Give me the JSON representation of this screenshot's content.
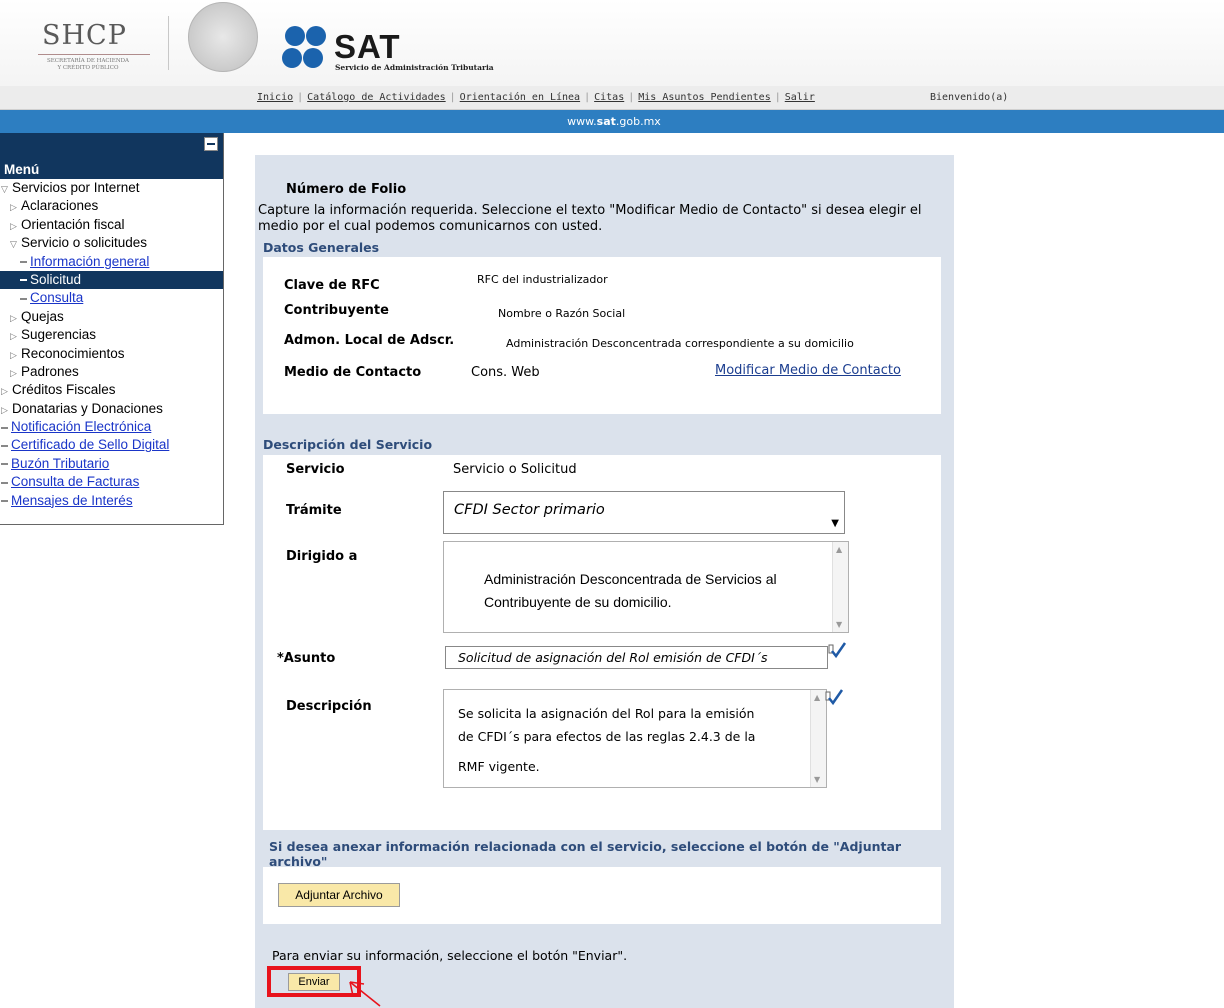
{
  "header": {
    "shcp_name": "SHCP",
    "shcp_sub1": "SECRETARÍA DE HACIENDA",
    "shcp_sub2": "Y CRÉDITO PÚBLICO",
    "sat_name": "SAT",
    "sat_subtitle": "Servicio de Administración Tributaria"
  },
  "topnav": {
    "links": [
      "Inicio",
      "Catálogo de Actividades",
      "Orientación en Línea",
      "Citas",
      "Mis Asuntos Pendientes",
      "Salir"
    ],
    "welcome": "Bienvenido(a)"
  },
  "urlbar": {
    "prefix": "www.",
    "bold": "sat",
    "suffix": ".gob.mx"
  },
  "sidebar": {
    "title": "Menú",
    "items": [
      {
        "label": "Servicios por Internet",
        "level": 0,
        "marker": "open"
      },
      {
        "label": "Aclaraciones",
        "level": 1,
        "marker": "closed"
      },
      {
        "label": "Orientación fiscal",
        "level": 1,
        "marker": "closed"
      },
      {
        "label": "Servicio o solicitudes",
        "level": 1,
        "marker": "open"
      },
      {
        "label": "Información general",
        "level": 2,
        "marker": "dash",
        "link": true
      },
      {
        "label": "Solicitud",
        "level": 2,
        "marker": "dash",
        "link": true,
        "active": true
      },
      {
        "label": "Consulta",
        "level": 2,
        "marker": "dash",
        "link": true
      },
      {
        "label": "Quejas",
        "level": 1,
        "marker": "closed"
      },
      {
        "label": "Sugerencias",
        "level": 1,
        "marker": "closed"
      },
      {
        "label": "Reconocimientos",
        "level": 1,
        "marker": "closed"
      },
      {
        "label": "Padrones",
        "level": 1,
        "marker": "closed"
      },
      {
        "label": "Créditos Fiscales",
        "level": 0,
        "marker": "closed"
      },
      {
        "label": "Donatarias y Donaciones",
        "level": 0,
        "marker": "closed"
      },
      {
        "label": "Notificación Electrónica",
        "level": 0,
        "marker": "dash",
        "link": true
      },
      {
        "label": "Certificado de Sello Digital",
        "level": 0,
        "marker": "dash",
        "link": true
      },
      {
        "label": "Buzón Tributario",
        "level": 0,
        "marker": "dash",
        "link": true
      },
      {
        "label": "Consulta de Facturas",
        "level": 0,
        "marker": "dash",
        "link": true
      },
      {
        "label": "Mensajes de Interés",
        "level": 0,
        "marker": "dash",
        "link": true
      }
    ]
  },
  "form": {
    "folio_title": "Número de Folio",
    "intro": "Capture la información requerida. Seleccione el texto \"Modificar Medio de Contacto\" si desea elegir el medio por el cual podemos comunicarnos con usted.",
    "datos": {
      "title": "Datos Generales",
      "rfc_label": "Clave de RFC",
      "rfc_value": "RFC del industrializador",
      "contrib_label": "Contribuyente",
      "contrib_value": "Nombre o Razón Social",
      "admon_label": "Admon. Local de Adscr.",
      "admon_value": "Administración Desconcentrada  correspondiente a su domicilio",
      "contact_label": "Medio de Contacto",
      "contact_value": "Cons. Web",
      "modify_link": "Modificar Medio de Contacto"
    },
    "servicio": {
      "title": "Descripción del Servicio",
      "servicio_label": "Servicio",
      "servicio_value": "Servicio o Solicitud",
      "tramite_label": "Trámite",
      "tramite_value": "CFDI Sector primario",
      "dirigido_label": "Dirigido a",
      "dirigido_value": "Administración Desconcentrada de Servicios al Contribuyente de su domicilio.",
      "asunto_label": "*Asunto",
      "asunto_value": "Solicitud de asignación del Rol  emisión de CFDI´s",
      "desc_label": "Descripción",
      "desc_lines": [
        "Se solicita la asignación del Rol para la emisión",
        "de CFDI´s para efectos  de las reglas 2.4.3 de la",
        "RMF vigente."
      ]
    },
    "anexar_title": "Si desea anexar información relacionada con el servicio, seleccione el botón de \"Adjuntar archivo\"",
    "adjuntar_button": "Adjuntar Archivo",
    "enviar_note": "Para enviar su información, seleccione el botón \"Enviar\".",
    "enviar_button": "Enviar"
  },
  "colors": {
    "sidebar_dark": "#11365e",
    "url_bar": "#2d7ec1",
    "content_bg": "#dbe2ec",
    "button_bg": "#f9e8a8",
    "highlight_red": "#e8131c"
  }
}
